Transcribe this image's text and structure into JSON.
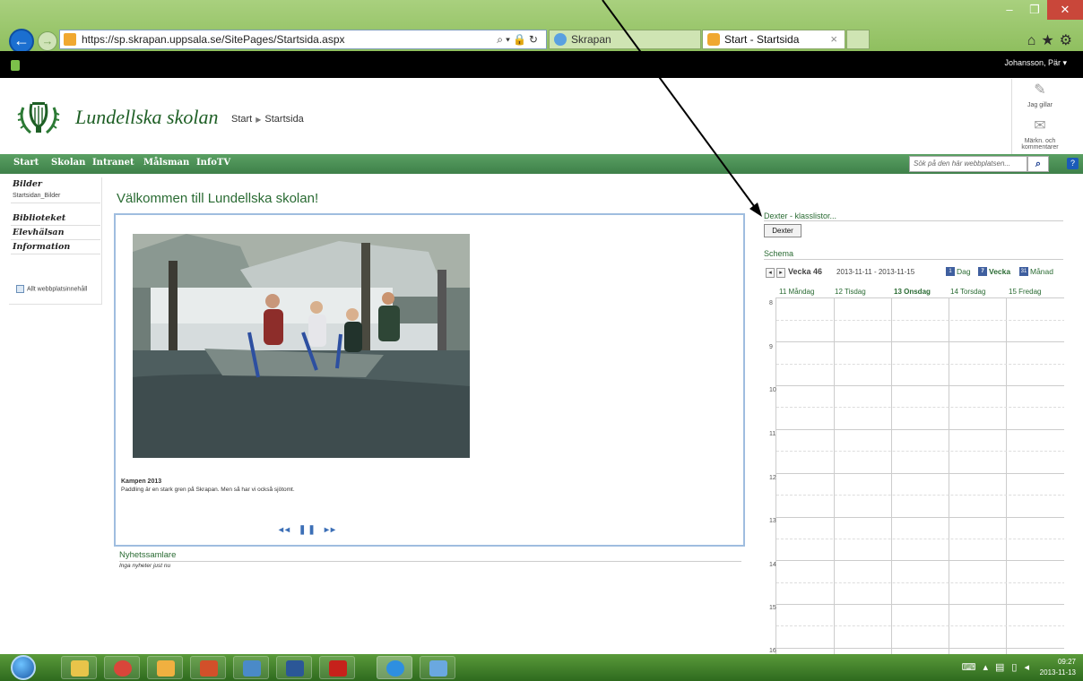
{
  "browser": {
    "url": "https://sp.skrapan.uppsala.se/SitePages/Startsida.aspx",
    "tabs": [
      {
        "label": "Skrapan"
      },
      {
        "label": "Start - Startsida"
      }
    ]
  },
  "suitebar": {
    "user": "Johansson, Pär ▾"
  },
  "header": {
    "site_title": "Lundellska skolan",
    "breadcrumb": [
      "Start",
      "Startsida"
    ],
    "like_label": "Jag gillar",
    "tags_label": "Märkn. och kommentarer"
  },
  "topnav": {
    "items": [
      "Start",
      "Skolan",
      "Intranet",
      "Målsman",
      "InfoTV"
    ],
    "search_placeholder": "Sök på den här webbplatsen..."
  },
  "leftnav": {
    "bilder": "Bilder",
    "bilder_sub": "Startsidan_Bilder",
    "biblioteket": "Biblioteket",
    "elevhalsan": "Elevhälsan",
    "information": "Information",
    "all_content": "Allt webbplatsinnehåll"
  },
  "main": {
    "welcome": "Välkommen till Lundellska skolan!",
    "caption_title": "Kampen 2013",
    "caption_text": "Paddling är en stark gren på Skrapan. Men så har vi också sjötomt.",
    "controls": [
      "◂◂",
      "❚❚",
      "▸▸"
    ],
    "news_title": "Nyhetssamlare",
    "news_empty": "Inga nyheter just nu"
  },
  "right": {
    "dexter_title": "Dexter - klasslistor...",
    "dexter_button": "Dexter",
    "schema_title": "Schema",
    "week_label": "Vecka 46",
    "week_range": "2013-11-11 - 2013-11-15",
    "views": [
      "Dag",
      "Vecka",
      "Månad"
    ],
    "days": [
      "11 Måndag",
      "12 Tisdag",
      "13 Onsdag",
      "14 Torsdag",
      "15 Fredag"
    ],
    "hours": [
      "8",
      "9",
      "10",
      "11",
      "12",
      "13",
      "14",
      "15",
      "16"
    ]
  },
  "taskbar": {
    "time": "09:27",
    "date": "2013-11-13"
  },
  "colors": {
    "brand_green": "#3e8049",
    "title_green": "#2a6b33",
    "chrome_green": "#8fbf5f"
  }
}
